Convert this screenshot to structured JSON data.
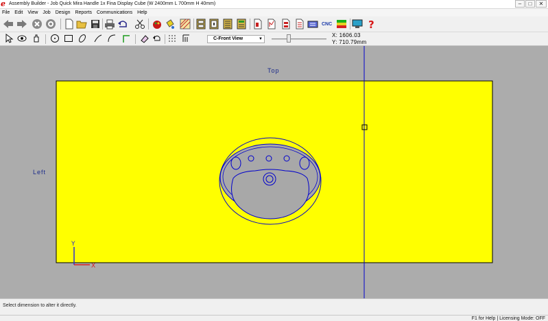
{
  "window": {
    "title": "Assembly Builder - Job Quick Mira Handle 1x Fina Display Cube (W 2400mm L 700mm H 40mm)",
    "controls": {
      "minimize": "–",
      "maximize": "□",
      "close": "✕"
    }
  },
  "menu": [
    "File",
    "Edit",
    "View",
    "Job",
    "Design",
    "Reports",
    "Communications",
    "Help"
  ],
  "toolbar_main": {
    "icons": [
      "back-arrow-icon",
      "forward-arrow-icon",
      "stop-icon",
      "refresh-icon",
      "new-file-icon",
      "open-folder-icon",
      "save-icon",
      "print-icon",
      "undo-icon",
      "scissors-icon",
      "palette-icon",
      "paint-bucket-icon",
      "grid-pattern-icon",
      "cabinet-icon",
      "cabinet-alt-icon",
      "cabinet-lines-icon",
      "report-icon",
      "report-alt-icon",
      "document-icon",
      "document-alt-icon",
      "document-list-icon",
      "machine-icon",
      "color-bars-icon",
      "monitor-icon",
      "help-question-icon"
    ],
    "machine_label": "CNC"
  },
  "toolbar_draw": {
    "icons": [
      "pointer-icon",
      "eye-icon",
      "pan-icon",
      "circle-icon",
      "rectangle-icon",
      "ellipse-icon",
      "line-icon",
      "arc-icon",
      "corner-icon",
      "eraser-icon",
      "undo-draw-icon",
      "dotted-grid-icon",
      "dimension-icon"
    ],
    "view_select": "C-Front View",
    "coord_x": "X: 1606.03",
    "coord_y": "Y: 710.79mm"
  },
  "canvas": {
    "label_top": "Top",
    "label_left": "Left",
    "axis_x": "X",
    "axis_y": "Y",
    "colors": {
      "background": "#acacac",
      "worktop": "#ffff00",
      "outline": "#0000cc",
      "sink": "#a8a8a8"
    }
  },
  "status": {
    "message": "Select dimension to alter it directly.",
    "right": "F1 for Help | Licensing Mode: OFF"
  }
}
